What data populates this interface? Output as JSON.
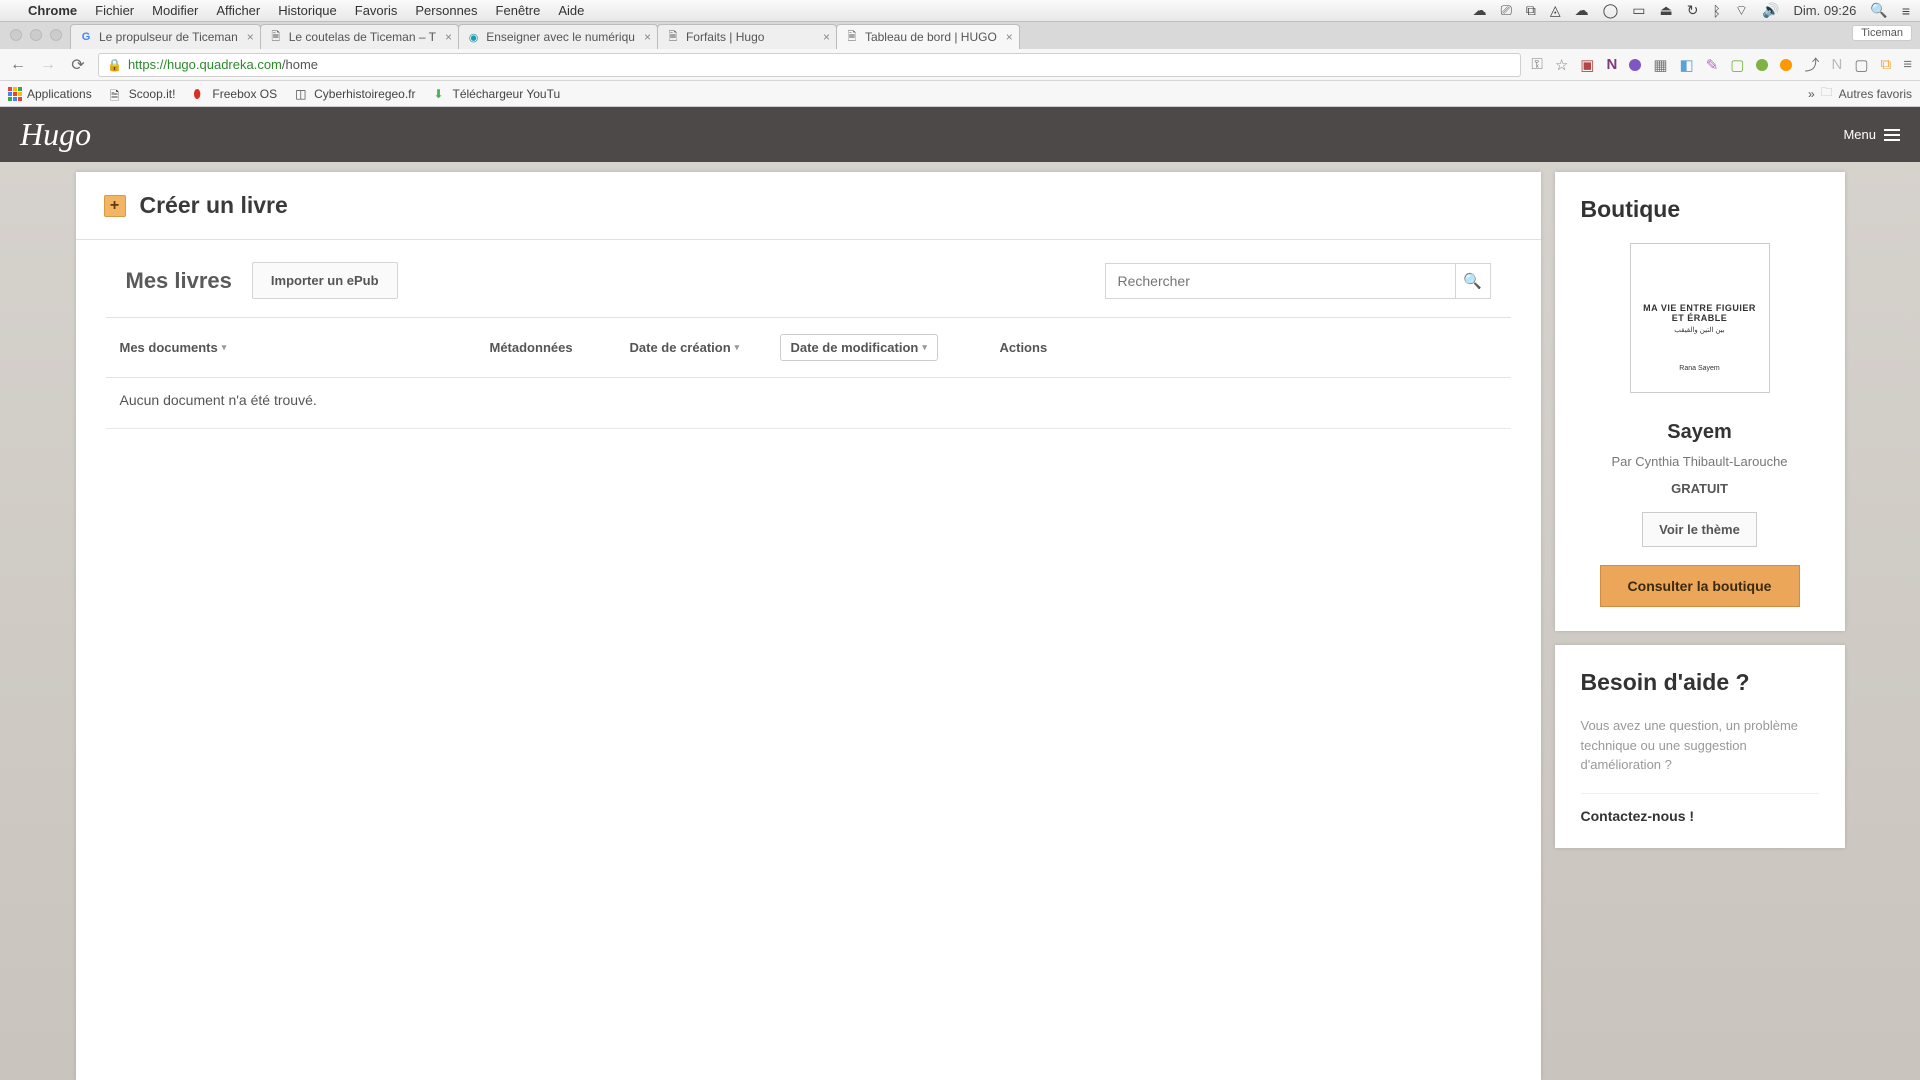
{
  "mac_menu": {
    "app": "Chrome",
    "items": [
      "Fichier",
      "Modifier",
      "Afficher",
      "Historique",
      "Favoris",
      "Personnes",
      "Fenêtre",
      "Aide"
    ],
    "clock": "Dim. 09:26",
    "user": "Ticeman"
  },
  "tabs": [
    {
      "label": "Le propulseur de Ticeman",
      "favicon": "G"
    },
    {
      "label": "Le coutelas de Ticeman – T",
      "favicon": "📄"
    },
    {
      "label": "Enseigner avec le numériqu",
      "favicon": "🌐"
    },
    {
      "label": "Forfaits | Hugo",
      "favicon": "📄"
    },
    {
      "label": "Tableau de bord | HUGO",
      "favicon": "📄",
      "active": true
    }
  ],
  "url": {
    "domain": "https://hugo.quadreka.com",
    "path": "/home"
  },
  "bookmarks": {
    "apps": "Applications",
    "items": [
      "Scoop.it!",
      "Freebox OS",
      "Cyberhistoiregeo.fr",
      "Téléchargeur YouTu"
    ],
    "other": "Autres favoris"
  },
  "app": {
    "logo": "Hugo",
    "menu_label": "Menu"
  },
  "create_bar": {
    "label": "Créer un livre"
  },
  "books": {
    "heading": "Mes livres",
    "import_label": "Importer un ePub",
    "search_placeholder": "Rechercher",
    "columns": {
      "docs": "Mes documents",
      "meta": "Métadonnées",
      "created": "Date de création",
      "modified": "Date de modification",
      "actions": "Actions"
    },
    "empty": "Aucun document n'a été trouvé."
  },
  "boutique": {
    "heading": "Boutique",
    "cover_title": "MA VIE ENTRE FIGUIER ET ÉRABLE",
    "cover_sub": "بين التين والقيقب",
    "cover_author": "Rana Sayem",
    "title": "Sayem",
    "author": "Par Cynthia Thibault-Larouche",
    "price": "GRATUIT",
    "theme_btn": "Voir le thème",
    "shop_btn": "Consulter la boutique"
  },
  "help": {
    "heading": "Besoin d'aide ?",
    "text": "Vous avez une question, un problème technique ou une suggestion d'amélioration ?",
    "link": "Contactez-nous !"
  }
}
